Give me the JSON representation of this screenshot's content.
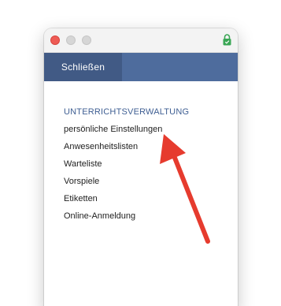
{
  "toolbar": {
    "close_label": "Schließen"
  },
  "menu": {
    "heading": "UNTERRICHTSVERWALTUNG",
    "items": [
      {
        "label": "persönliche Einstellungen"
      },
      {
        "label": "Anwesenheitslisten"
      },
      {
        "label": "Warteliste"
      },
      {
        "label": "Vorspiele"
      },
      {
        "label": "Etiketten"
      },
      {
        "label": "Online-Anmeldung"
      }
    ]
  },
  "colors": {
    "toolbar": "#4e6c9d",
    "close_button": "#415a85",
    "heading": "#3f5f93",
    "annotation_arrow": "#e63b2e",
    "close_dot": "#ee5b55",
    "lock_icon": "#3aa655"
  },
  "icons": {
    "lock": "lock-icon",
    "arrow": "annotation-arrow-icon"
  }
}
